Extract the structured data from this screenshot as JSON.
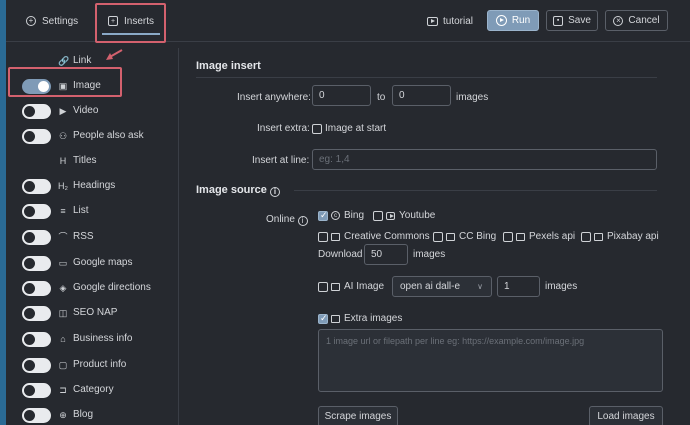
{
  "tabs": {
    "settings": "Settings",
    "inserts": "Inserts"
  },
  "toolbar": {
    "tutorial": "tutorial",
    "run": "Run",
    "save": "Save",
    "cancel": "Cancel"
  },
  "colors": {
    "accent": "#7f9bb7",
    "highlight": "#d3616e",
    "background": "#26292f"
  },
  "sidebar": {
    "items": [
      {
        "label": "Link",
        "icon": "link-icon",
        "toggle": null
      },
      {
        "label": "Image",
        "icon": "image-icon",
        "toggle": "on"
      },
      {
        "label": "Video",
        "icon": "video-icon",
        "toggle": "off"
      },
      {
        "label": "People also ask",
        "icon": "people-icon",
        "toggle": "off"
      },
      {
        "label": "Titles",
        "icon": "titles-icon",
        "toggle": null
      },
      {
        "label": "Headings",
        "icon": "headings-icon",
        "toggle": "off"
      },
      {
        "label": "List",
        "icon": "list-icon",
        "toggle": "off"
      },
      {
        "label": "RSS",
        "icon": "rss-icon",
        "toggle": "off"
      },
      {
        "label": "Google maps",
        "icon": "map-icon",
        "toggle": "off"
      },
      {
        "label": "Google directions",
        "icon": "directions-icon",
        "toggle": "off"
      },
      {
        "label": "SEO NAP",
        "icon": "seo-nap-icon",
        "toggle": "off"
      },
      {
        "label": "Business info",
        "icon": "business-icon",
        "toggle": "off"
      },
      {
        "label": "Product info",
        "icon": "product-icon",
        "toggle": "off"
      },
      {
        "label": "Category",
        "icon": "category-icon",
        "toggle": "off"
      },
      {
        "label": "Blog",
        "icon": "globe-icon",
        "toggle": "off"
      }
    ]
  },
  "image_insert": {
    "title": "Image insert",
    "insert_anywhere_label": "Insert anywhere:",
    "from_value": "0",
    "to_label": "to",
    "to_value": "0",
    "images_label": "images",
    "insert_extra_label": "Insert extra:",
    "image_at_start_label": "Image at start",
    "insert_at_line_label": "Insert at line:",
    "insert_at_line_placeholder": "eg: 1,4"
  },
  "image_source": {
    "title": "Image source",
    "online_label": "Online",
    "sources": {
      "bing": "Bing",
      "youtube": "Youtube",
      "creative_commons": "Creative Commons",
      "cc_bing": "CC Bing",
      "pexels": "Pexels api",
      "pixabay": "Pixabay api"
    },
    "download_label": "Download",
    "download_value": "50",
    "download_unit": "images",
    "ai_image_label": "AI Image",
    "ai_model": "open ai dall-e",
    "ai_count": "1",
    "ai_unit": "images",
    "extra_images_label": "Extra images",
    "extra_images_placeholder": "1 image url or filepath per line eg: https://example.com/image.jpg",
    "scrape_button": "Scrape images",
    "load_button": "Load images"
  }
}
